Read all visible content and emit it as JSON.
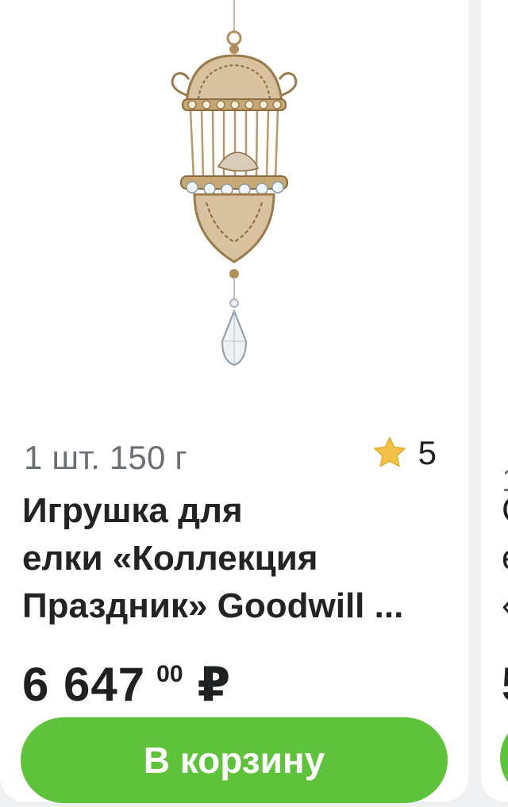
{
  "product": {
    "quantity_weight": "1 шт. 150 г",
    "rating": "5",
    "star_icon": "star-icon",
    "star_color": "#f3c04a",
    "title_lines": [
      "Игрушка для",
      "елки «Коллекция",
      "Праздник» Goodwill ..."
    ],
    "price_main": "6 647",
    "price_cents": "00",
    "currency": "₽",
    "cart_button_label": "В корзину",
    "button_color": "#5ec33a"
  },
  "next_card": {
    "peek_lines": [
      "1",
      "С",
      "е",
      "«",
      "5"
    ]
  }
}
